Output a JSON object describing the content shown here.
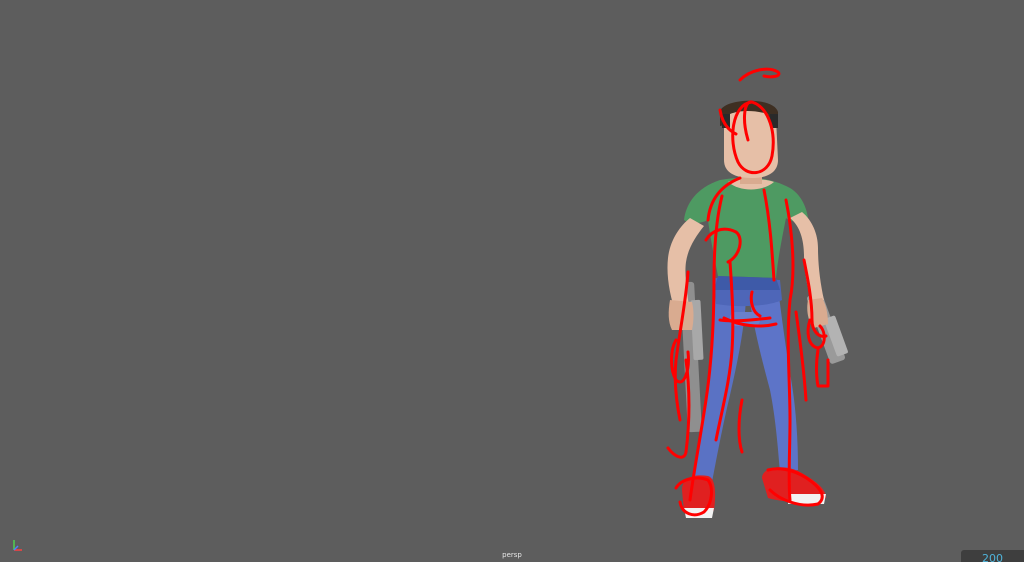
{
  "viewport": {
    "camera_label": "persp",
    "frame_value": "200",
    "background": "#5d5d5d"
  },
  "scene": {
    "character": "cartoon-character-model",
    "overlay": "red-sketch-strokes",
    "colors": {
      "shirt": "#4e9a62",
      "pants": "#5a72c4",
      "skin": "#e6bfa7",
      "hair": "#4a3a2a",
      "shoes": "#e02020",
      "sketch": "#ff0000",
      "props": "#9a9a9a"
    }
  },
  "icons": {
    "axis": "axis-gizmo-icon"
  }
}
